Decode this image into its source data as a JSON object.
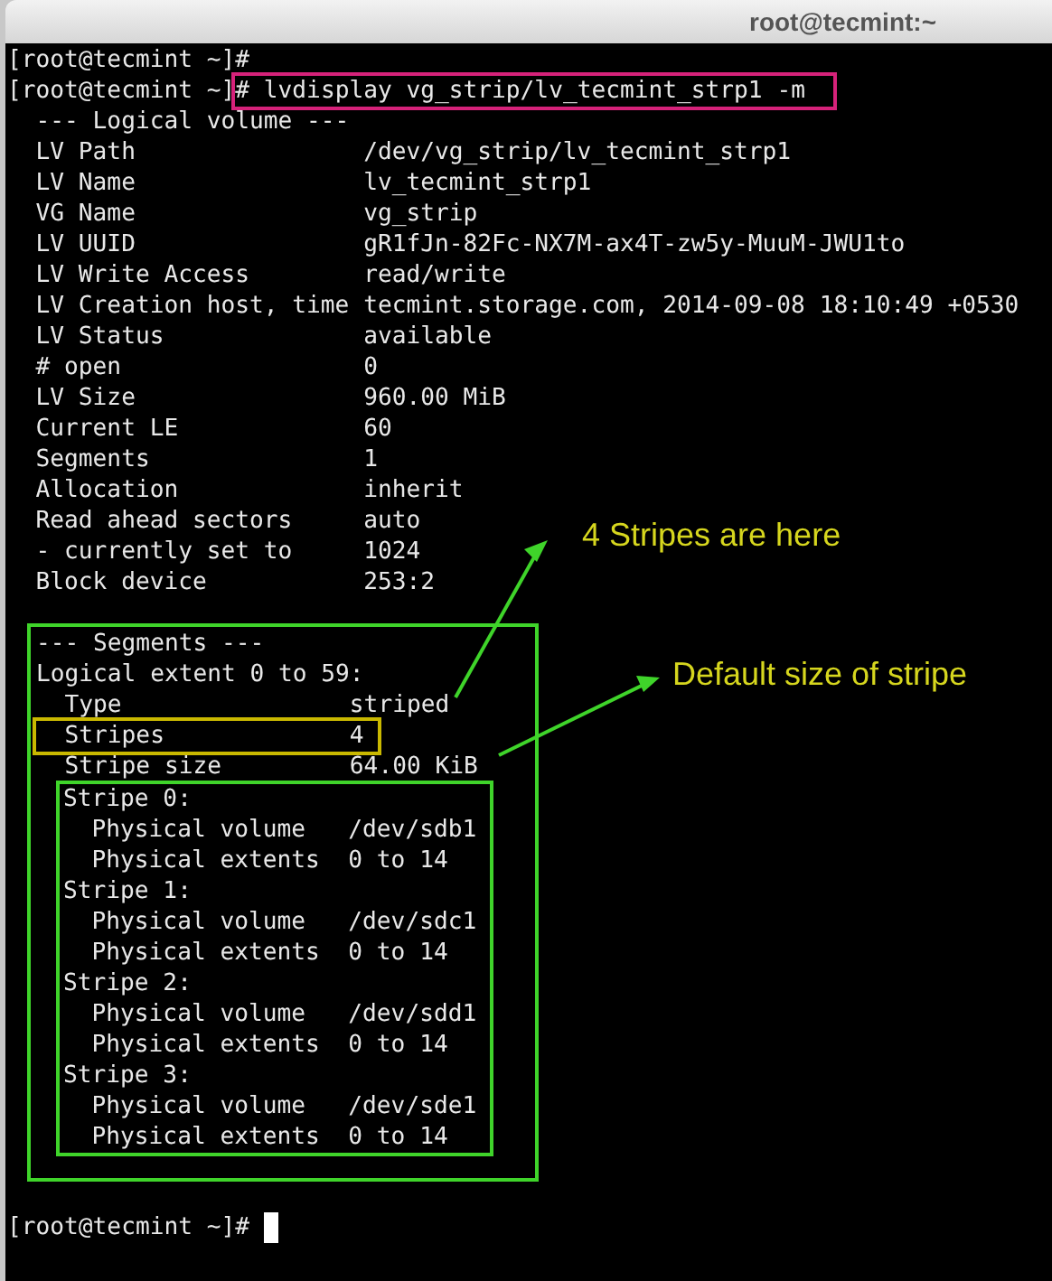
{
  "window": {
    "title": "root@tecmint:~"
  },
  "terminal": {
    "history": [
      "[root@tecmint ~]#"
    ],
    "command": {
      "prompt": "[root@tecmint ~]",
      "input": "# lvdisplay vg_strip/lv_tecmint_strp1 -m",
      "highlighted": true
    },
    "lv_header": "--- Logical volume ---",
    "lv_fields": [
      {
        "label": "LV Path",
        "value": "/dev/vg_strip/lv_tecmint_strp1"
      },
      {
        "label": "LV Name",
        "value": "lv_tecmint_strp1"
      },
      {
        "label": "VG Name",
        "value": "vg_strip"
      },
      {
        "label": "LV UUID",
        "value": "gR1fJn-82Fc-NX7M-ax4T-zw5y-MuuM-JWU1to"
      },
      {
        "label": "LV Write Access",
        "value": "read/write"
      },
      {
        "label": "LV Creation host, time",
        "value": "tecmint.storage.com, 2014-09-08 18:10:49 +0530"
      },
      {
        "label": "LV Status",
        "value": "available"
      },
      {
        "label": "# open",
        "value": "0"
      },
      {
        "label": "LV Size",
        "value": "960.00 MiB"
      },
      {
        "label": "Current LE",
        "value": "60"
      },
      {
        "label": "Segments",
        "value": "1"
      },
      {
        "label": "Allocation",
        "value": "inherit"
      },
      {
        "label": "Read ahead sectors",
        "value": "auto"
      },
      {
        "label": "- currently set to",
        "value": "1024"
      },
      {
        "label": "Block device",
        "value": "253:2"
      }
    ],
    "segments": {
      "header": "--- Segments ---",
      "extent": "Logical extent 0 to 59:",
      "highlighted": true,
      "fields": [
        {
          "label": "Type",
          "value": "striped",
          "highlighted": false
        },
        {
          "label": "Stripes",
          "value": "4",
          "highlighted": true
        },
        {
          "label": "Stripe size",
          "value": "64.00 KiB",
          "highlighted": false
        }
      ],
      "stripes_highlighted": true,
      "stripes": [
        {
          "title": "Stripe 0:",
          "fields": [
            {
              "label": "Physical volume",
              "value": "/dev/sdb1"
            },
            {
              "label": "Physical extents",
              "value": "0 to 14"
            }
          ]
        },
        {
          "title": "Stripe 1:",
          "fields": [
            {
              "label": "Physical volume",
              "value": "/dev/sdc1"
            },
            {
              "label": "Physical extents",
              "value": "0 to 14"
            }
          ]
        },
        {
          "title": "Stripe 2:",
          "fields": [
            {
              "label": "Physical volume",
              "value": "/dev/sdd1"
            },
            {
              "label": "Physical extents",
              "value": "0 to 14"
            }
          ]
        },
        {
          "title": "Stripe 3:",
          "fields": [
            {
              "label": "Physical volume",
              "value": "/dev/sde1"
            },
            {
              "label": "Physical extents",
              "value": "0 to 14"
            }
          ]
        }
      ]
    },
    "final_prompt": "[root@tecmint ~]#"
  },
  "annotations": [
    {
      "text": "4 Stripes are here"
    },
    {
      "text": "Default size of stripe"
    }
  ]
}
